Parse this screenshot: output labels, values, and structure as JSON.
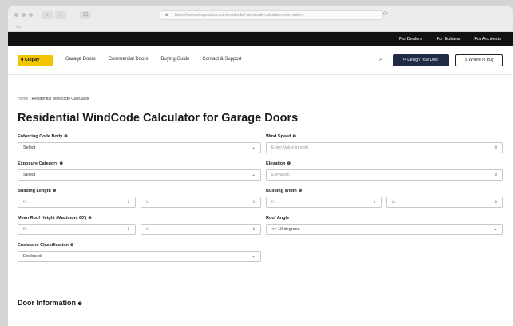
{
  "browser": {
    "url": "https://www.shopupdoor.com/residential-windcode-calculator/information",
    "nav_back": "‹",
    "nav_forward": "›",
    "sidebar": "⊡",
    "reload": "⟳",
    "tab_icon": "▭"
  },
  "topbar": {
    "links": [
      "For Dealers",
      "For Builders",
      "For Architects"
    ]
  },
  "header": {
    "logo": "■ Clopay",
    "nav": [
      "Garage Doors",
      "Commercial Doors",
      "Buying Guide",
      "Contact & Support"
    ],
    "search_icon": "⌕",
    "design_button": "✂ Design Your Door",
    "where_button": "⊙ Where To Buy"
  },
  "breadcrumb": {
    "home": "Home",
    "current": "/ Residential Windcode Calculator"
  },
  "page": {
    "title": "Residential WindCode Calculator for Garage Doors"
  },
  "fields": {
    "code_body": {
      "label": "Enforcing Code Body",
      "value": "Select"
    },
    "wind_speed": {
      "label": "Wind Speed",
      "placeholder": "Enter Value in mph"
    },
    "exposure": {
      "label": "Exposure Category",
      "value": "Select"
    },
    "elevation": {
      "label": "Elevation",
      "placeholder": "Elevation"
    },
    "building_length": {
      "label": "Building Length",
      "ft": "ft",
      "in": "in"
    },
    "building_width": {
      "label": "Building Width",
      "ft": "ft",
      "in": "in"
    },
    "roof_height": {
      "label": "Mean Roof Height (Maximum 60')",
      "ft": "ft",
      "in": "in"
    },
    "roof_angle": {
      "label": "Roof Angle",
      "value": "<= 10 degrees"
    },
    "enclosure": {
      "label": "Enclosure Classification",
      "value": "Enclosed"
    }
  },
  "info_icon": "❶",
  "chevron": "⌄",
  "spinner": "⇕",
  "section": {
    "door_info": "Door Information"
  }
}
